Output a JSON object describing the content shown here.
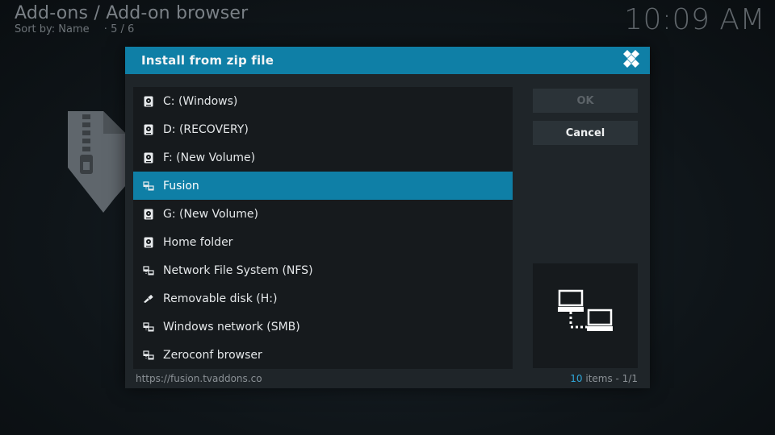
{
  "background": {
    "breadcrumb": "Add-ons / Add-on browser",
    "sort_label": "Sort by: Name",
    "sort_sep": "·",
    "position": "5 / 6",
    "clock": "10:09 AM"
  },
  "dialog": {
    "title": "Install from zip file",
    "ok_label": "OK",
    "cancel_label": "Cancel",
    "path": "https://fusion.tvaddons.co",
    "item_count": "10",
    "items_suffix": "items - 1/1"
  },
  "items": [
    {
      "label": "C: (Windows)",
      "icon": "hard-drive-icon"
    },
    {
      "label": "D: (RECOVERY)",
      "icon": "hard-drive-icon"
    },
    {
      "label": "F: (New Volume)",
      "icon": "hard-drive-icon"
    },
    {
      "label": "Fusion",
      "icon": "network-icon",
      "selected": true
    },
    {
      "label": "G: (New Volume)",
      "icon": "hard-drive-icon"
    },
    {
      "label": "Home folder",
      "icon": "hard-drive-icon"
    },
    {
      "label": "Network File System (NFS)",
      "icon": "network-icon"
    },
    {
      "label": "Removable disk (H:)",
      "icon": "usb-icon"
    },
    {
      "label": "Windows network (SMB)",
      "icon": "network-icon"
    },
    {
      "label": "Zeroconf browser",
      "icon": "network-icon"
    }
  ],
  "colors": {
    "accent": "#0f7fa6",
    "dialog_bg": "#1f2529",
    "list_bg": "#161a1d",
    "count_highlight": "#2fa5d6"
  }
}
